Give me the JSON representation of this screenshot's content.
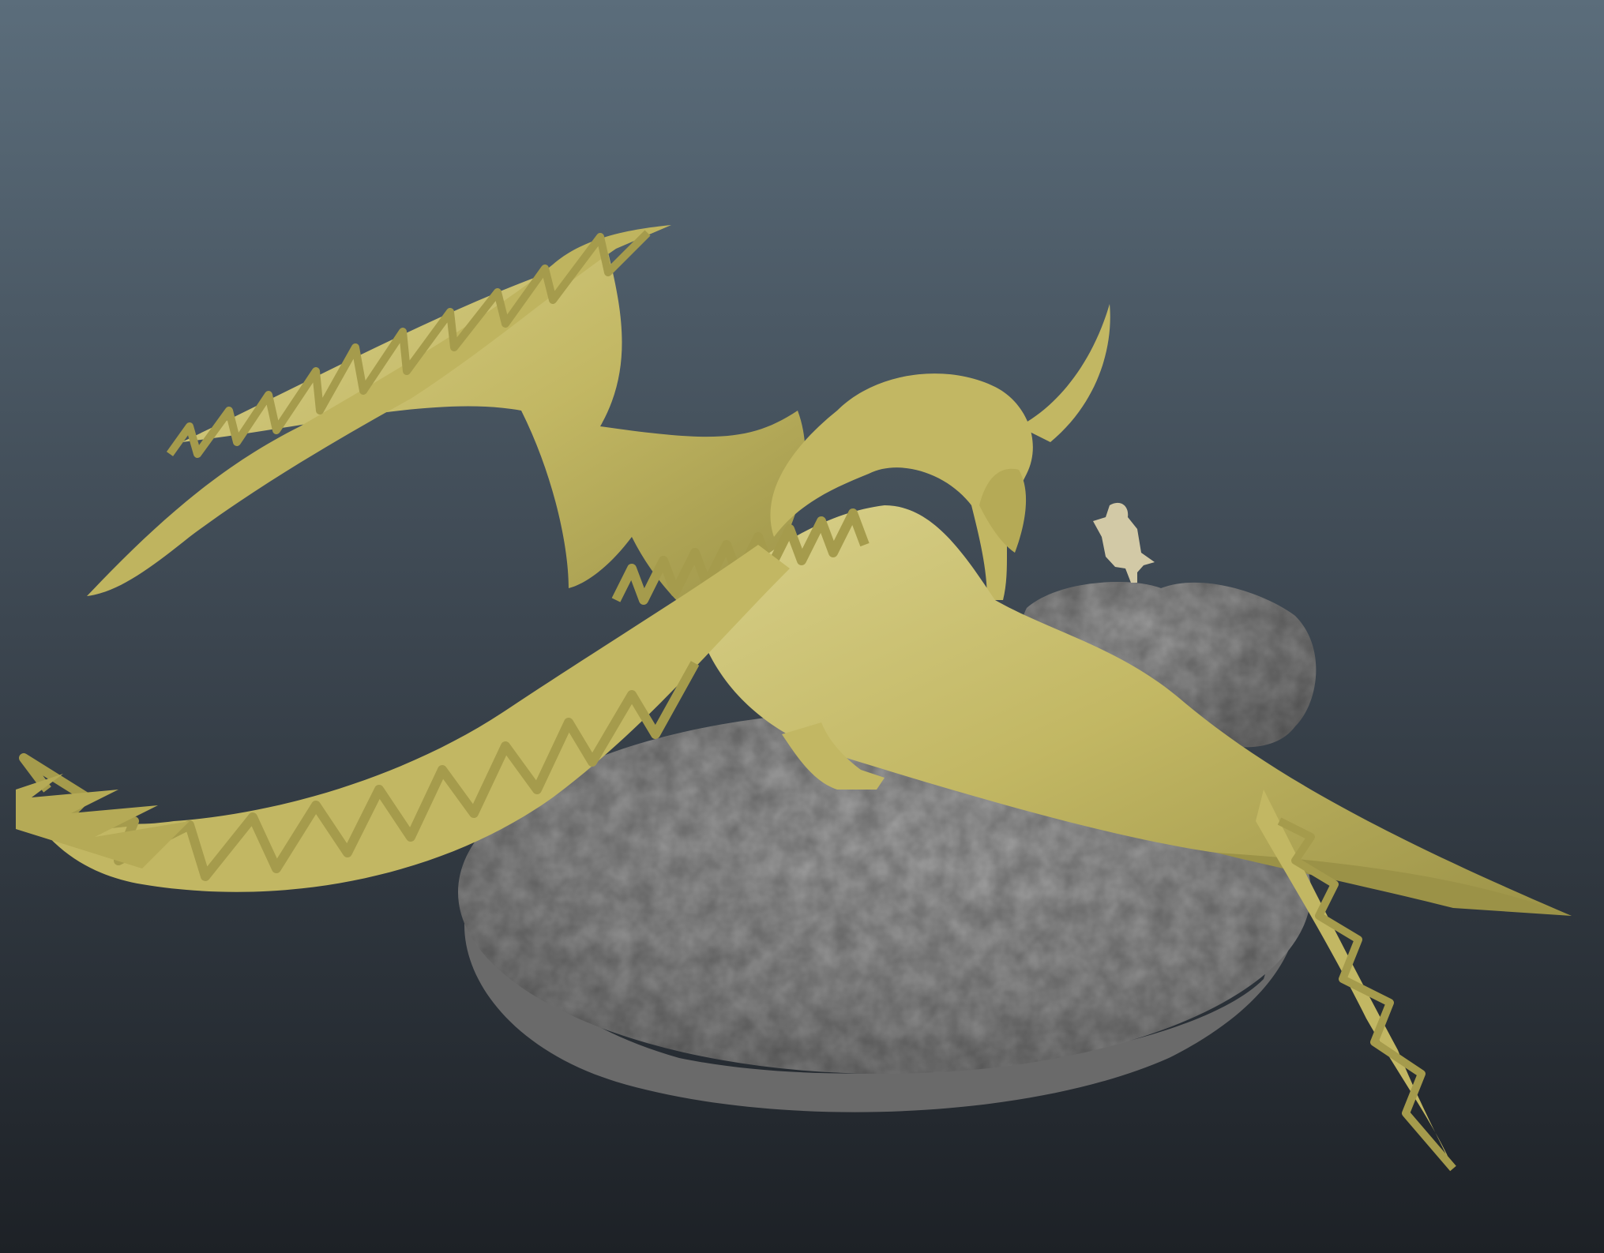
{
  "viewport": {
    "background_top": "#5b6d7b",
    "background_mid": "#3c4650",
    "background_bottom": "#1d2126"
  },
  "model": {
    "creature_color": "#c2b763",
    "creature_shadow": "#7d7638",
    "creature_highlight": "#d8d08a",
    "base_color": "#8f8f8f",
    "base_shadow": "#6c6c6c",
    "figurine_color": "#d2c9a6"
  }
}
